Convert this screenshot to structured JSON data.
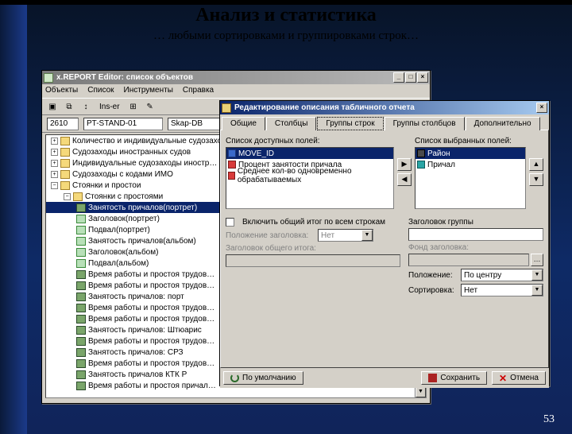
{
  "slide": {
    "title": "Анализ и статистика",
    "subtitle": "… любыми сортировками и группировками строк…",
    "page_number": "53"
  },
  "editor": {
    "title": "x.REPORT Editor: список объектов",
    "menu": [
      "Объекты",
      "Список",
      "Инструменты",
      "Справка"
    ],
    "toolbar_insert_label": "Ins-er",
    "search_code": "2610",
    "search_name": "PT-STAND-01",
    "search_skap": "Skap-DB",
    "tree": [
      {
        "d": 0,
        "t": "folder",
        "exp": "+",
        "label": "Количество и индивидуальные судозахо…"
      },
      {
        "d": 0,
        "t": "folder",
        "exp": "+",
        "label": "Судозаходы иностранных судов"
      },
      {
        "d": 0,
        "t": "folder",
        "exp": "+",
        "label": "Индивидуальные судозаходы иностр…"
      },
      {
        "d": 0,
        "t": "folder",
        "exp": "+",
        "label": "Судозаходы с кодами ИМО"
      },
      {
        "d": 0,
        "t": "folder",
        "exp": "-",
        "label": "Стоянки и простои"
      },
      {
        "d": 1,
        "t": "folder",
        "exp": "-",
        "label": "Стоянки с простоями"
      },
      {
        "d": 2,
        "t": "bar",
        "sel": true,
        "label": "Занятость причалов(портрет)"
      },
      {
        "d": 2,
        "t": "item",
        "label": "Заголовок(портрет)"
      },
      {
        "d": 2,
        "t": "item",
        "label": "Подвал(портрет)"
      },
      {
        "d": 2,
        "t": "item",
        "label": "Занятость причалов(альбом)"
      },
      {
        "d": 2,
        "t": "item",
        "label": "Заголовок(альбом)"
      },
      {
        "d": 2,
        "t": "item",
        "label": "Подвал(альбом)"
      },
      {
        "d": 2,
        "t": "bar",
        "label": "Время работы и простоя трудов…"
      },
      {
        "d": 2,
        "t": "bar",
        "label": "Время работы и простоя трудов…"
      },
      {
        "d": 2,
        "t": "bar",
        "label": "Занятость причалов: порт"
      },
      {
        "d": 2,
        "t": "bar",
        "label": "Время работы и простоя трудов…"
      },
      {
        "d": 2,
        "t": "bar",
        "label": "Время работы и простоя трудов…"
      },
      {
        "d": 2,
        "t": "bar",
        "label": "Занятость причалов: Штюарис"
      },
      {
        "d": 2,
        "t": "bar",
        "label": "Время работы и простоя трудов…"
      },
      {
        "d": 2,
        "t": "bar",
        "label": "Занятость причалов: СРЗ"
      },
      {
        "d": 2,
        "t": "bar",
        "label": "Время работы и простоя трудов…"
      },
      {
        "d": 2,
        "t": "bar",
        "label": "Занятость причалов КТК Р"
      },
      {
        "d": 2,
        "t": "bar",
        "label": "Время работы и простоя причал…"
      }
    ]
  },
  "dialog": {
    "title": "Редактирование описания табличного отчета",
    "tabs": [
      "Общие",
      "Столбцы",
      "Группы строк",
      "Группы столбцов",
      "Дополнительно"
    ],
    "active_tab": 2,
    "left_label": "Список доступных полей:",
    "right_label": "Список выбранных полей:",
    "left_list": [
      {
        "ic": "blue",
        "label": "MOVE_ID",
        "sel": true
      },
      {
        "ic": "red",
        "label": "Процент занятости причала"
      },
      {
        "ic": "red",
        "label": "Среднее кол-во одновременно обрабатываемых"
      }
    ],
    "right_list": [
      {
        "ic": "dark",
        "label": "Район",
        "sel": true
      },
      {
        "ic": "teal",
        "label": "Причал"
      }
    ],
    "checkbox_label": "Включить общий итог по всем строкам",
    "pos_label": "Положение заголовка:",
    "pos_value": "Нет",
    "total_header_label": "Заголовок общего итога:",
    "total_header_value": "",
    "group_header_label": "Заголовок группы",
    "group_header_value": "",
    "font_label": "Фонд заголовка:",
    "font_value": "",
    "align_label": "Положение:",
    "align_value": "По центру",
    "sort_label": "Сортировка:",
    "sort_value": "Нет",
    "btn_default": "По умолчанию",
    "btn_save": "Сохранить",
    "btn_cancel": "Отмена"
  }
}
